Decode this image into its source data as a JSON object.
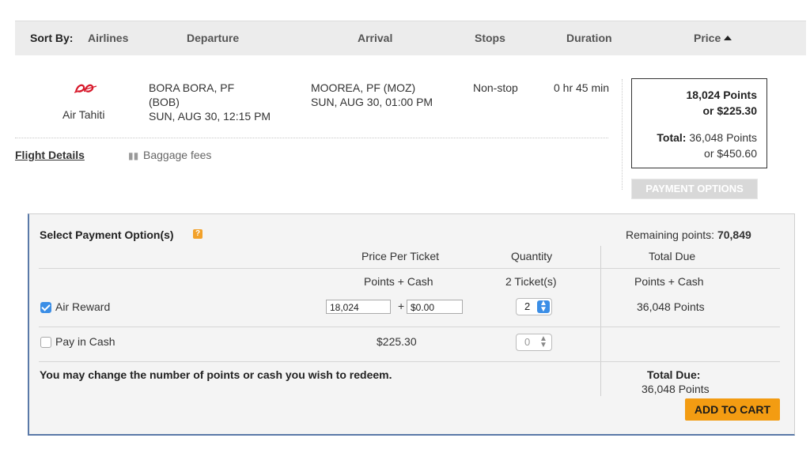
{
  "sort": {
    "label": "Sort By:",
    "columns": [
      "Airlines",
      "Departure",
      "Arrival",
      "Stops",
      "Duration",
      "Price"
    ]
  },
  "flight": {
    "airline": "Air Tahiti",
    "departure": {
      "city": "BORA BORA, PF",
      "code": "(BOB)",
      "time": "SUN, AUG 30, 12:15 PM"
    },
    "arrival": {
      "city": "MOOREA, PF (MOZ)",
      "time": "SUN, AUG 30, 01:00 PM"
    },
    "stops": "Non-stop",
    "duration": "0 hr 45 min",
    "price": {
      "points": "18,024 Points",
      "cash": "or $225.30",
      "total_label": "Total:",
      "total_points": "36,048 Points",
      "total_cash": "or $450.60"
    },
    "payment_options_button": "PAYMENT OPTIONS",
    "flight_details_link": "Flight Details",
    "baggage_fees_link": "Baggage fees"
  },
  "payment": {
    "title": "Select Payment Option(s)",
    "help_icon": "?",
    "remaining_label": "Remaining points:",
    "remaining_value": "70,849",
    "headers": {
      "price_per_ticket": "Price Per Ticket",
      "quantity": "Quantity",
      "total_due": "Total Due"
    },
    "subheaders": {
      "points_cash": "Points + Cash",
      "tickets": "2 Ticket(s)",
      "total_points_cash": "Points + Cash"
    },
    "rows": [
      {
        "label": "Air Reward",
        "checked": true,
        "points": "18,024",
        "cash_prefix": "+",
        "cash": "$0.00",
        "quantity": "2",
        "total": "36,048 Points"
      },
      {
        "label": "Pay in Cash",
        "checked": false,
        "price": "$225.30",
        "quantity": "0"
      }
    ],
    "note": "You may change the number of points or cash you wish to redeem.",
    "total_due_label": "Total Due:",
    "total_due_value": "36,048 Points",
    "add_to_cart": "ADD TO CART"
  },
  "colors": {
    "accent_blue": "#3b8ee6",
    "add_to_cart": "#f39c12",
    "airline_logo": "#d7182a",
    "panel_border": "#5a79a8"
  }
}
